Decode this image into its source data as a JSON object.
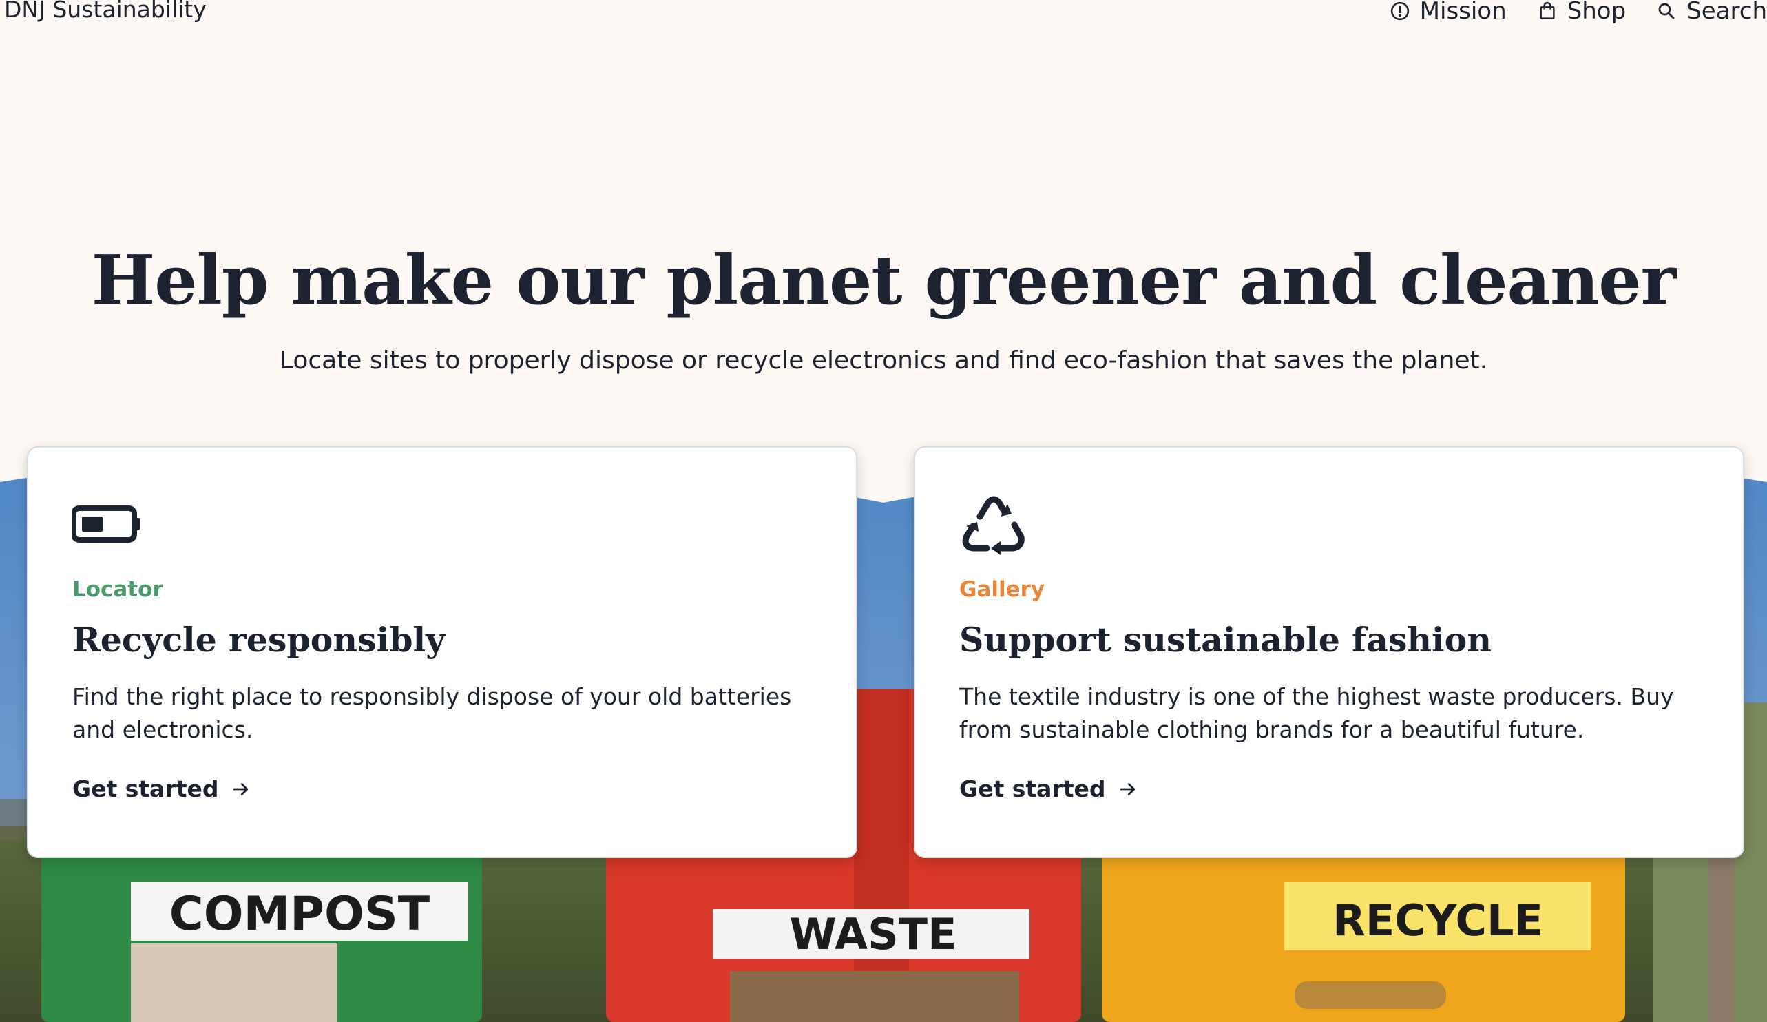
{
  "header": {
    "brand": "DNJ Sustainability",
    "nav": [
      {
        "label": "Mission",
        "icon": "info-circle-icon"
      },
      {
        "label": "Shop",
        "icon": "shopping-bag-icon"
      },
      {
        "label": "Search",
        "icon": "search-icon"
      }
    ]
  },
  "hero": {
    "title": "Help make our planet greener and cleaner",
    "subtitle": "Locate sites to properly dispose or recycle electronics and find eco-fashion that saves the planet."
  },
  "cards": [
    {
      "icon": "battery-low-icon",
      "eyebrow": "Locator",
      "eyebrow_color": "#4a9a6a",
      "title": "Recycle responsibly",
      "text": "Find the right place to responsibly dispose of your old batteries and electronics.",
      "link": "Get started"
    },
    {
      "icon": "recycle-icon",
      "eyebrow": "Gallery",
      "eyebrow_color": "#e8873a",
      "title": "Support sustainable fashion",
      "text": "The textile industry is one of the highest waste producers. Buy from sustainable clothing brands for a beautiful future.",
      "link": "Get started"
    }
  ],
  "photo": {
    "bin_labels": [
      "COMPOST",
      "WASTE",
      "RECYCLE"
    ],
    "bin_colors": [
      "#2f8a45",
      "#d9382a",
      "#f0a61c"
    ]
  }
}
